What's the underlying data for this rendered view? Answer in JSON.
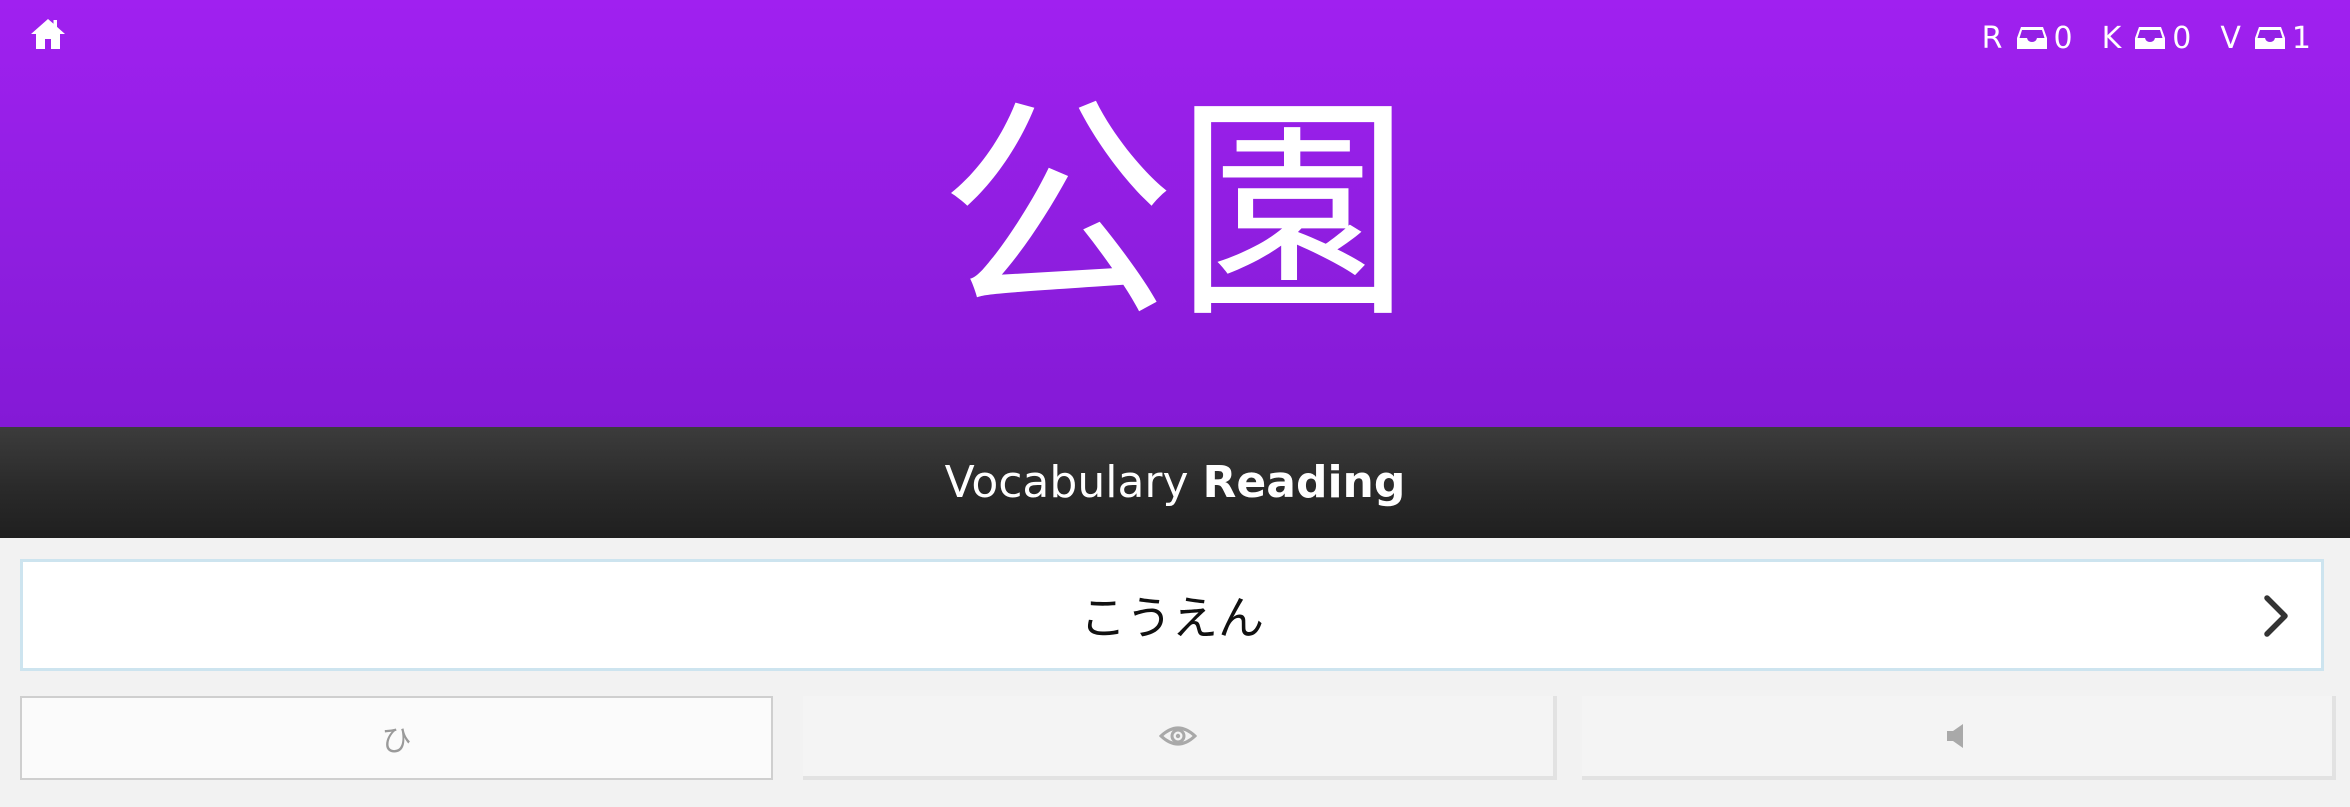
{
  "header": {
    "counts": [
      {
        "letter": "R",
        "value": "0"
      },
      {
        "letter": "K",
        "value": "0"
      },
      {
        "letter": "V",
        "value": "1"
      }
    ],
    "icons": {
      "home": "home-icon",
      "inbox": "inbox-icon"
    }
  },
  "question": {
    "character": "公園"
  },
  "prompt": {
    "category": "Vocabulary",
    "type": "Reading"
  },
  "answer": {
    "value": "こうえん",
    "placeholder": ""
  },
  "buttons": {
    "kana_label": "ひ",
    "reveal_icon": "eye-icon",
    "audio_icon": "speaker-icon",
    "submit_icon": "chevron-right-icon"
  },
  "colors": {
    "header_background": "#9b21ec",
    "band_background": "#2a2a2a",
    "input_border": "#cde4ef"
  }
}
